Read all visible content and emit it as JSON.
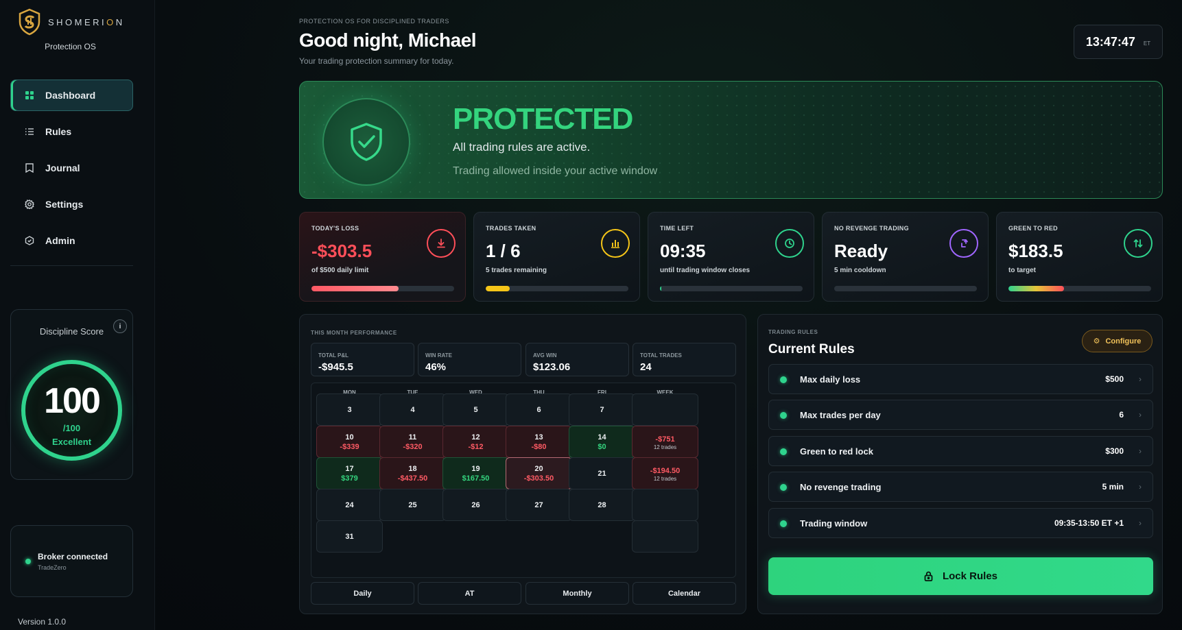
{
  "brand": {
    "name_part1": "SHOMERI",
    "name_accent": "O",
    "name_part2": "N",
    "subtitle": "Protection OS"
  },
  "nav": [
    {
      "label": "Dashboard",
      "icon": "grid-icon",
      "active": true
    },
    {
      "label": "Rules",
      "icon": "list-icon"
    },
    {
      "label": "Journal",
      "icon": "book-icon"
    },
    {
      "label": "Settings",
      "icon": "gear-icon"
    },
    {
      "label": "Admin",
      "icon": "shield-icon"
    }
  ],
  "discipline": {
    "title": "Discipline Score",
    "info": "i",
    "score": "100",
    "max": "/100",
    "grade": "Excellent"
  },
  "broker": {
    "status": "Broker connected",
    "name": "TradeZero"
  },
  "version": "Version 1.0.0",
  "header": {
    "eyebrow": "PROTECTION OS FOR DISCIPLINED TRADERS",
    "greeting": "Good night, Michael",
    "subtitle": "Your trading protection summary for today.",
    "clock": "13:47:47",
    "timezone": "ET"
  },
  "hero": {
    "status": "PROTECTED",
    "line1": "All trading rules are active.",
    "line2": "Trading allowed inside your active window"
  },
  "stats": [
    {
      "label": "TODAY'S LOSS",
      "value": "-$303.5",
      "sub": "of $500 daily limit",
      "icon": "arrow-down-icon",
      "progress": 0.61
    },
    {
      "label": "TRADES TAKEN",
      "value": "1 / 6",
      "sub": "5 trades remaining",
      "icon": "bar-chart-icon",
      "progress": 0.17
    },
    {
      "label": "TIME LEFT",
      "value": "09:35",
      "sub": "until trading window closes",
      "icon": "clock-icon",
      "progress": 0.01
    },
    {
      "label": "NO REVENGE TRADING",
      "value": "Ready",
      "sub": "5 min cooldown",
      "icon": "cycle-icon",
      "progress": 0
    },
    {
      "label": "GREEN TO RED",
      "value": "$183.5",
      "sub": "to target",
      "icon": "swap-icon",
      "progress": 0.39
    }
  ],
  "colors": {
    "accent": "#2fd38d",
    "loss": "#ff4f59",
    "trades": "#f5c518",
    "revenge": "#a066ff",
    "warning": "#f1c25a"
  },
  "performance": {
    "title": "THIS MONTH PERFORMANCE",
    "kpis": [
      {
        "label": "TOTAL P&L",
        "value": "-$945.5"
      },
      {
        "label": "WIN RATE",
        "value": "46%"
      },
      {
        "label": "AVG WIN",
        "value": "$123.06"
      },
      {
        "label": "TOTAL TRADES",
        "value": "24"
      }
    ],
    "weekdays": [
      "MON",
      "TUE",
      "WED",
      "THU",
      "FRI",
      "WEEK"
    ],
    "weeks": [
      [
        {
          "day": "3"
        },
        {
          "day": "4"
        },
        {
          "day": "5"
        },
        {
          "day": "6"
        },
        {
          "day": "7"
        },
        {
          "day": ""
        }
      ],
      [
        {
          "day": "10",
          "pnl": "-$339",
          "tone": "red"
        },
        {
          "day": "11",
          "pnl": "-$320",
          "tone": "red"
        },
        {
          "day": "12",
          "pnl": "-$12",
          "tone": "red"
        },
        {
          "day": "13",
          "pnl": "-$80",
          "tone": "red"
        },
        {
          "day": "14",
          "pnl": "$0",
          "tone": "green"
        },
        {
          "day": "",
          "pnl": "-$751",
          "trades": "12 trades",
          "tone": "red"
        }
      ],
      [
        {
          "day": "17",
          "pnl": "$379",
          "tone": "green"
        },
        {
          "day": "18",
          "pnl": "-$437.50",
          "tone": "red"
        },
        {
          "day": "19",
          "pnl": "$167.50",
          "tone": "green"
        },
        {
          "day": "20",
          "pnl": "-$303.50",
          "tone": "today"
        },
        {
          "day": "21"
        },
        {
          "day": "",
          "pnl": "-$194.50",
          "trades": "12 trades",
          "tone": "red"
        }
      ],
      [
        {
          "day": "24"
        },
        {
          "day": "25"
        },
        {
          "day": "26"
        },
        {
          "day": "27"
        },
        {
          "day": "28"
        },
        {
          "day": ""
        }
      ],
      [
        {
          "day": "31"
        },
        null,
        null,
        null,
        null,
        {
          "day": ""
        }
      ]
    ],
    "views": [
      "Daily",
      "AT",
      "Monthly",
      "Calendar"
    ]
  },
  "rules": {
    "eyebrow": "TRADING RULES",
    "title": "Current Rules",
    "configure": "Configure",
    "items": [
      {
        "name": "Max daily loss",
        "value": "$500"
      },
      {
        "name": "Max trades per day",
        "value": "6"
      },
      {
        "name": "Green to red lock",
        "value": "$300"
      },
      {
        "name": "No revenge trading",
        "value": "5 min"
      },
      {
        "name": "Trading window",
        "value": "09:35-13:50 ET +1"
      }
    ],
    "lock_label": "Lock Rules"
  }
}
